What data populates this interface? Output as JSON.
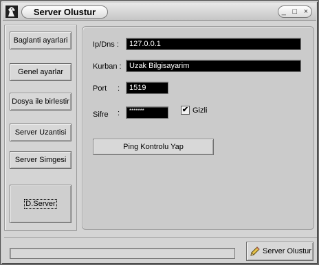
{
  "window": {
    "title": "Server Olustur",
    "minimize_glyph": "_",
    "maximize_glyph": "□",
    "close_glyph": "×"
  },
  "sidebar": {
    "items": [
      {
        "label": "Baglanti ayarlari"
      },
      {
        "label": "Genel ayarlar"
      },
      {
        "label": "Dosya ile birlestir"
      },
      {
        "label": "Server Uzantisi"
      },
      {
        "label": "Server Simgesi"
      },
      {
        "label": "D.Server"
      }
    ]
  },
  "form": {
    "ip_label": "Ip/Dns :",
    "ip_value": "127.0.0.1",
    "victim_label": "Kurban :",
    "victim_value": "Uzak Bilgisayarim",
    "port_label": "Port",
    "port_colon": ":",
    "port_value": "1519",
    "password_label": "Sifre",
    "password_colon": ":",
    "password_value": "*******",
    "hidden_checkbox_label": "Gizli",
    "hidden_checked": true,
    "ping_button_label": "Ping Kontrolu Yap"
  },
  "footer": {
    "progress_fraction": 0,
    "create_button_label": "Server Olustur"
  },
  "icons": {
    "app": "horse-head-icon",
    "create": "pencil-icon"
  },
  "colors": {
    "field_bg": "#000000",
    "field_text": "#ffffff",
    "window_bg": "#d4d4d4"
  }
}
